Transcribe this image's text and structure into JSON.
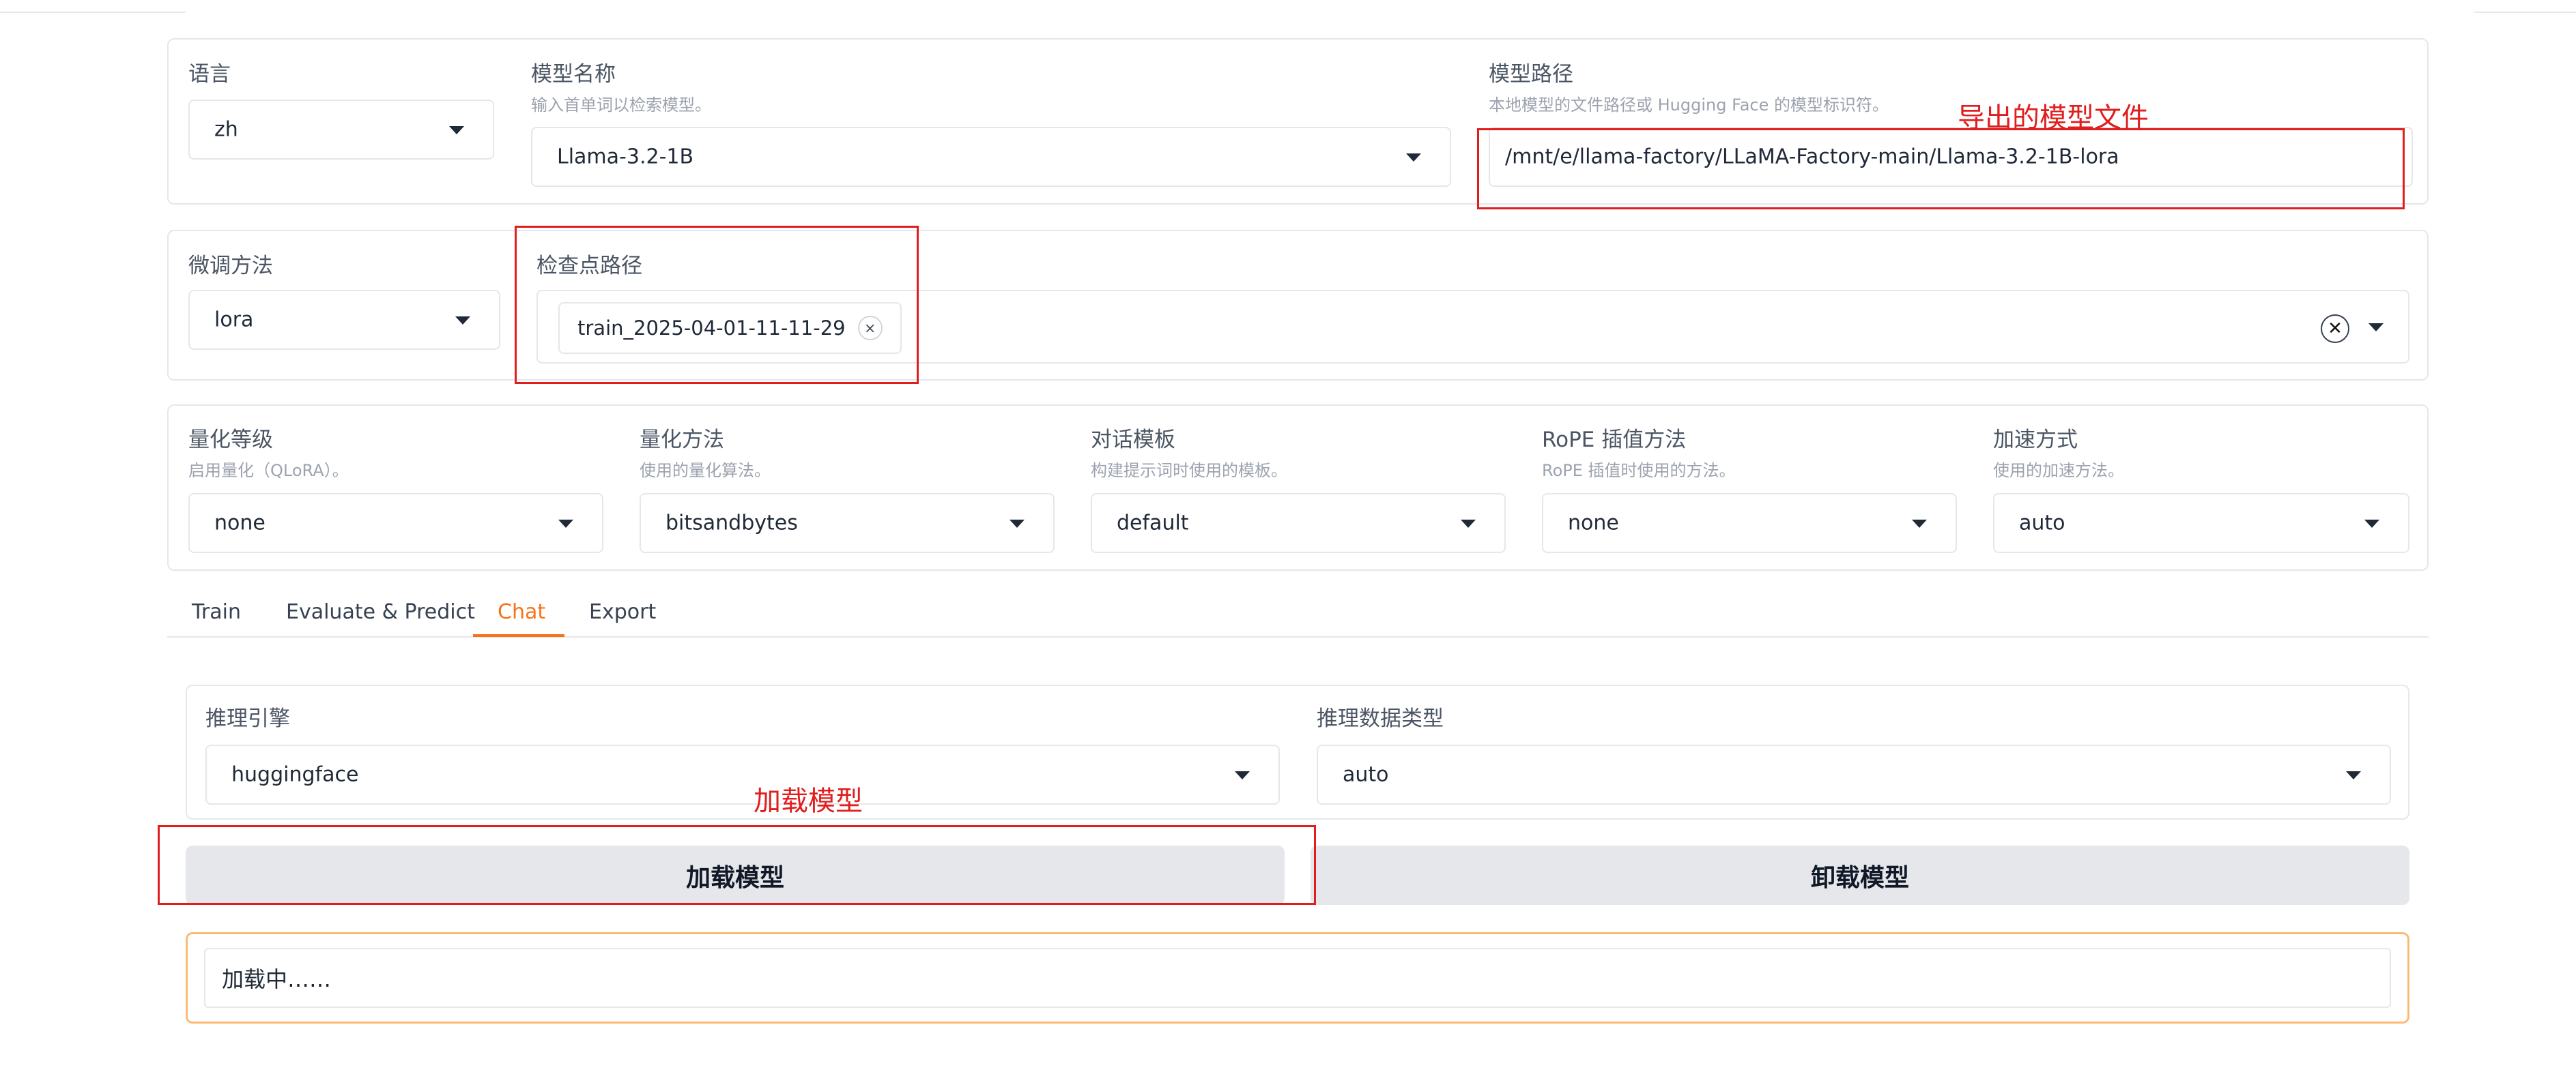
{
  "top_settings": {
    "language": {
      "label": "语言",
      "value": "zh"
    },
    "model_name": {
      "label": "模型名称",
      "description": "输入首单词以检索模型。",
      "value": "Llama-3.2-1B"
    },
    "model_path": {
      "label": "模型路径",
      "description": "本地模型的文件路径或 Hugging Face 的模型标识符。",
      "value": "/mnt/e/llama-factory/LLaMA-Factory-main/Llama-3.2-1B-lora"
    }
  },
  "finetune": {
    "method": {
      "label": "微调方法",
      "value": "lora"
    },
    "checkpoint": {
      "label": "检查点路径",
      "chips": [
        "train_2025-04-01-11-11-29"
      ],
      "chip_remove": "×",
      "clear_all": "✕"
    }
  },
  "advanced": {
    "quant_level": {
      "label": "量化等级",
      "description": "启用量化（QLoRA）。",
      "value": "none"
    },
    "quant_method": {
      "label": "量化方法",
      "description": "使用的量化算法。",
      "value": "bitsandbytes"
    },
    "template": {
      "label": "对话模板",
      "description": "构建提示词时使用的模板。",
      "value": "default"
    },
    "rope": {
      "label": "RoPE 插值方法",
      "description": "RoPE 插值时使用的方法。",
      "value": "none"
    },
    "booster": {
      "label": "加速方式",
      "description": "使用的加速方法。",
      "value": "auto"
    }
  },
  "tabs": [
    {
      "label": "Train",
      "active": false
    },
    {
      "label": "Evaluate & Predict",
      "active": false
    },
    {
      "label": "Chat",
      "active": true
    },
    {
      "label": "Export",
      "active": false
    }
  ],
  "chat": {
    "infer_backend": {
      "label": "推理引擎",
      "value": "huggingface"
    },
    "infer_dtype": {
      "label": "推理数据类型",
      "value": "auto"
    },
    "load_button": "加载模型",
    "unload_button": "卸载模型",
    "status_text": "加载中……"
  },
  "annotations": {
    "export_note": "导出的模型文件",
    "load_note": "加载模型"
  },
  "colors": {
    "accent": "#f97316",
    "annotation_red": "#e11d1d",
    "button_bg": "#e5e7eb",
    "status_border": "#fdba74"
  }
}
